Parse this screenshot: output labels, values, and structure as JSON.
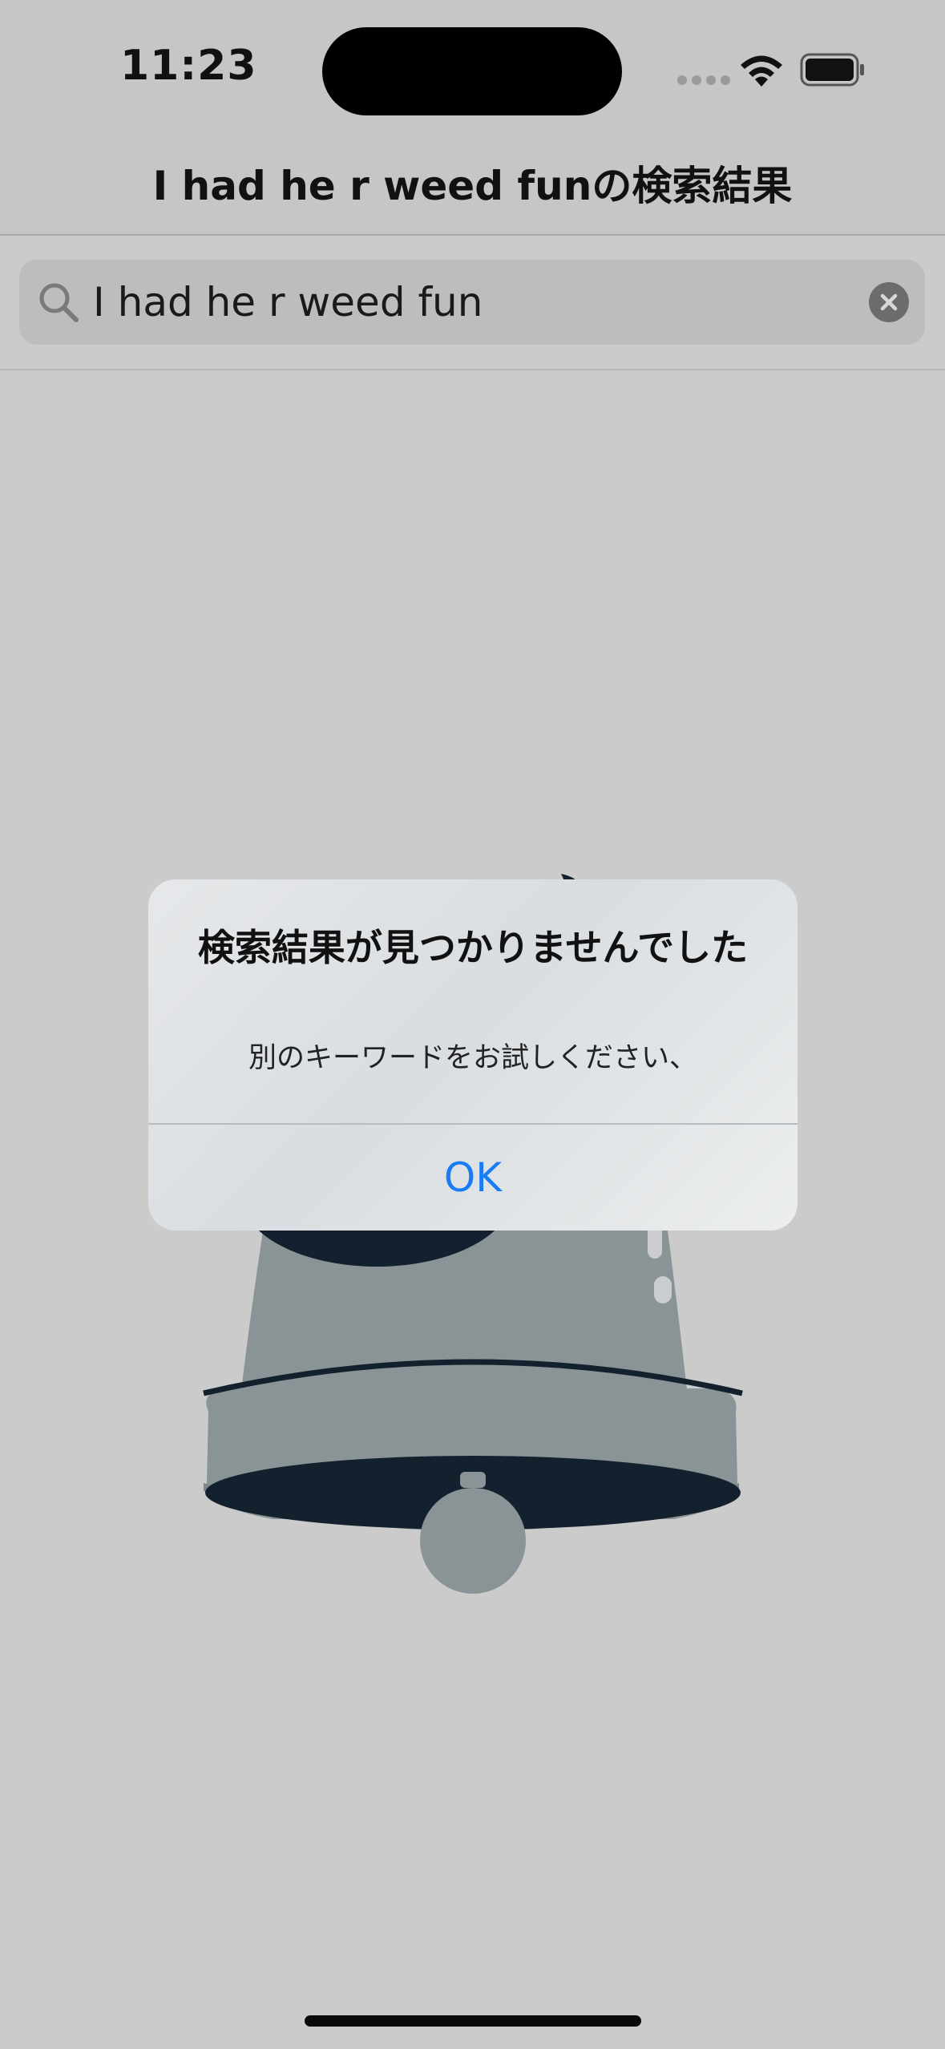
{
  "status_bar": {
    "time": "11:23",
    "icons": [
      "cellular-dots-icon",
      "wifi-icon",
      "battery-icon"
    ]
  },
  "nav": {
    "title": "I had he r weed funの検索結果"
  },
  "search": {
    "value": "I had he r weed fun",
    "icon": "search-icon",
    "clear_icon": "clear-icon"
  },
  "illustration": {
    "name": "bell-illustration"
  },
  "alert": {
    "title": "検索結果が見つかりませんでした",
    "message": "別のキーワードをお試しください、",
    "ok_label": "OK"
  },
  "colors": {
    "background": "#cbcbcb",
    "accent": "#1a7cf4",
    "bell_body": "#8a9396",
    "bell_dark": "#13202e"
  }
}
